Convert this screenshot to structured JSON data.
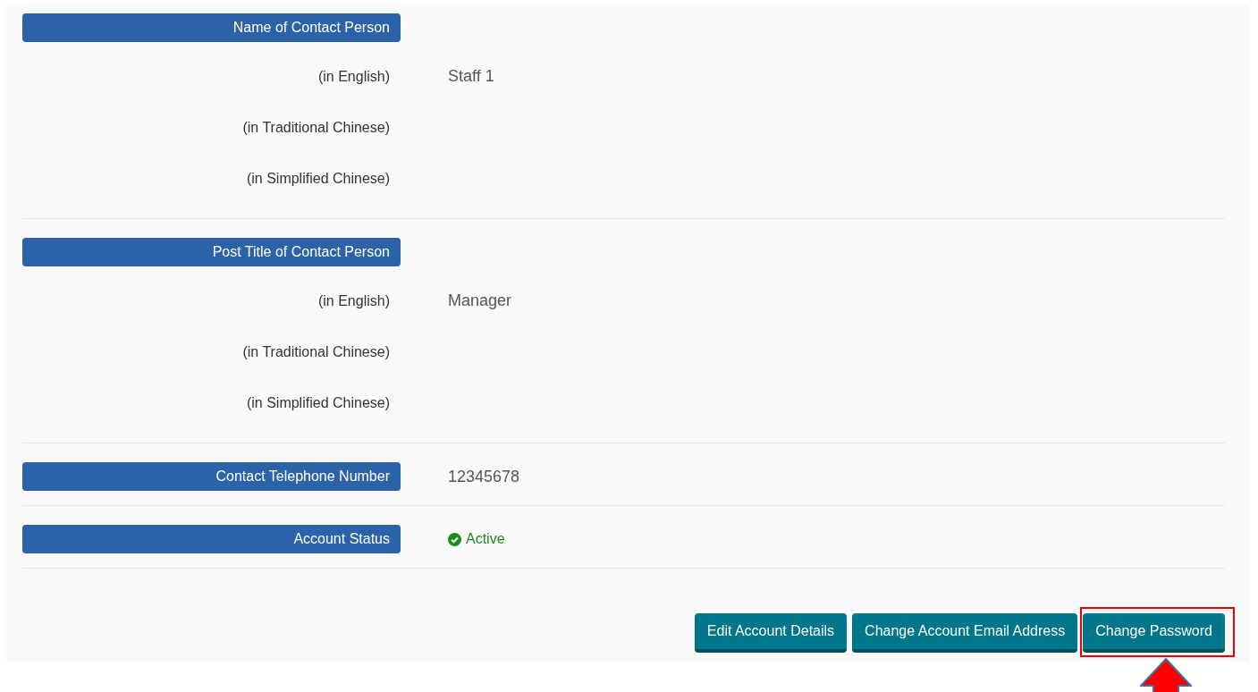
{
  "sections": [
    {
      "kind": "multilingual",
      "label": "Name of Contact Person",
      "rows": [
        {
          "label": "(in English)",
          "value": "Staff 1"
        },
        {
          "label": "(in Traditional Chinese)"
        },
        {
          "label": "(in Simplified Chinese)"
        }
      ]
    },
    {
      "kind": "multilingual",
      "label": "Post Title of Contact Person",
      "rows": [
        {
          "label": "(in English)",
          "value": "Manager"
        },
        {
          "label": "(in Traditional Chinese)"
        },
        {
          "label": "(in Simplified Chinese)"
        }
      ]
    },
    {
      "kind": "single",
      "label": "Contact Telephone Number",
      "value": "12345678"
    },
    {
      "kind": "status",
      "label": "Account Status",
      "value": "Active",
      "active": true
    }
  ],
  "buttons": [
    {
      "label": "Edit Account Details",
      "highlighted": false
    },
    {
      "label": "Change Account Email Address",
      "highlighted": false
    },
    {
      "label": "Change Password",
      "highlighted": true
    }
  ]
}
